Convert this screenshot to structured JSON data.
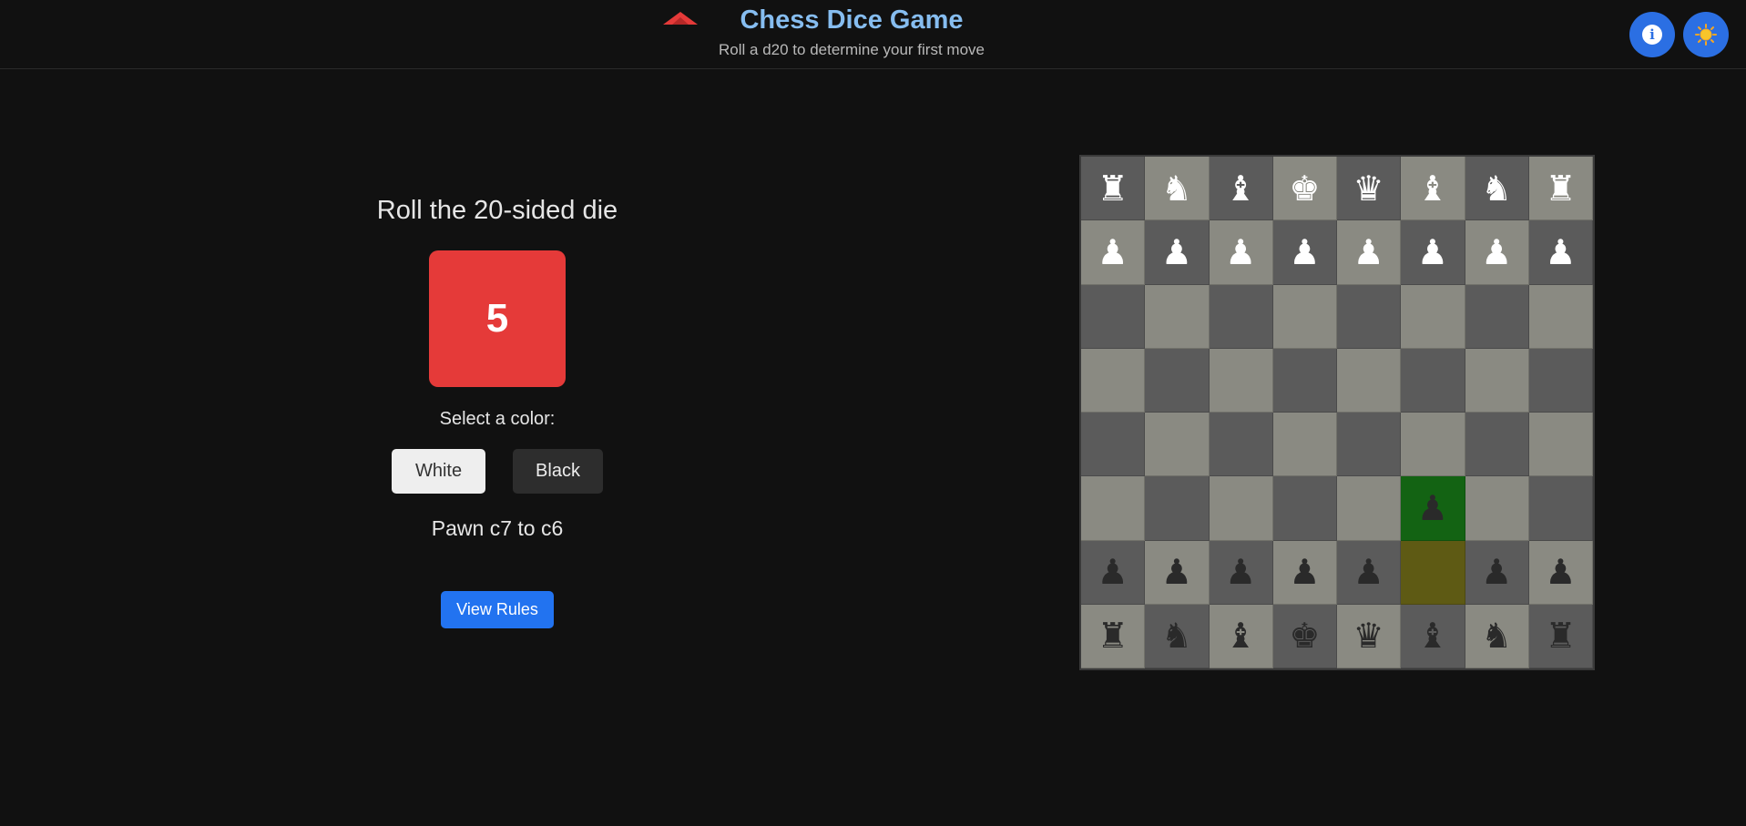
{
  "header": {
    "title": "Chess Dice Game",
    "subtitle": "Roll a d20 to determine your first move",
    "logo_icon": "red-tent-logo",
    "info_icon": "info-icon",
    "theme_icon": "sun-icon"
  },
  "panel": {
    "title": "Roll the 20-sided die",
    "die_value": "5",
    "select_label": "Select a color:",
    "white_label": "White",
    "black_label": "Black",
    "move_text": "Pawn c7 to c6",
    "rules_label": "View Rules"
  },
  "colors": {
    "accent_blue": "#2273f0",
    "die_red": "#e53a39",
    "title_blue": "#86bdf0",
    "board_light": "#8a8a82",
    "board_dark": "#5b5b5b",
    "highlight_target": "#136313",
    "highlight_source": "#5e5a14"
  },
  "board": {
    "rows": [
      [
        "wr",
        "wn",
        "wb",
        "wk",
        "wq",
        "wb",
        "wn",
        "wr"
      ],
      [
        "wp",
        "wp",
        "wp",
        "wp",
        "wp",
        "wp",
        "wp",
        "wp"
      ],
      [
        "",
        "",
        "",
        "",
        "",
        "",
        "",
        ""
      ],
      [
        "",
        "",
        "",
        "",
        "",
        "",
        "",
        ""
      ],
      [
        "",
        "",
        "",
        "",
        "",
        "",
        "",
        ""
      ],
      [
        "",
        "",
        "",
        "",
        "",
        "bp",
        "",
        ""
      ],
      [
        "bp",
        "bp",
        "bp",
        "bp",
        "bp",
        "",
        "bp",
        "bp"
      ],
      [
        "br",
        "bn",
        "bb",
        "bk",
        "bq",
        "bb",
        "bn",
        "br"
      ]
    ],
    "highlight_target": [
      5,
      5
    ],
    "highlight_source": [
      6,
      5
    ]
  }
}
